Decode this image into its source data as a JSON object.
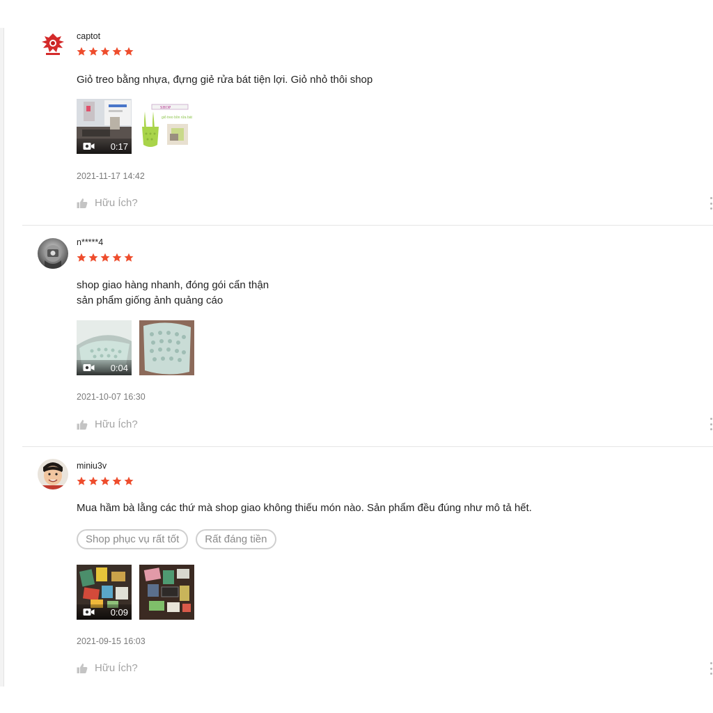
{
  "colors": {
    "star": "#ee4d2d",
    "muted_text": "#a3a3a3",
    "date_text": "#7a7a7a",
    "divider": "#e5e5e5"
  },
  "reviews": [
    {
      "username": "captot",
      "rating": 5,
      "comment_lines": [
        "Giỏ treo bằng nhựa, đựng giẻ rửa bát tiện lợi. Giỏ nhỏ thôi shop"
      ],
      "tags": [],
      "media": [
        {
          "type": "video",
          "duration": "0:17",
          "icon": "video-camera-icon"
        },
        {
          "type": "image",
          "logo_text": "SHOP",
          "caption_text": "giỏ treo bồn rửa bát"
        }
      ],
      "date": "2021-11-17 14:42",
      "helpful_label": "Hữu Ích?",
      "helpful_icon": "thumbs-up-icon"
    },
    {
      "username": "n*****4",
      "rating": 5,
      "comment_lines": [
        "shop giao hàng nhanh, đóng gói cẩn thận",
        "sản phẩm giống ảnh quảng cáo"
      ],
      "tags": [],
      "media": [
        {
          "type": "video",
          "duration": "0:04",
          "icon": "video-camera-icon"
        },
        {
          "type": "image"
        }
      ],
      "date": "2021-10-07 16:30",
      "helpful_label": "Hữu Ích?",
      "helpful_icon": "thumbs-up-icon"
    },
    {
      "username": "miniu3v",
      "rating": 5,
      "comment_lines": [
        "Mua hầm bà lằng các thứ mà shop giao không thiếu món nào. Sản phẩm đều đúng như mô tả hết."
      ],
      "tags": [
        "Shop phục vụ rất tốt",
        "Rất đáng tiền"
      ],
      "media": [
        {
          "type": "video",
          "duration": "0:09",
          "icon": "video-camera-icon"
        },
        {
          "type": "image"
        }
      ],
      "date": "2021-09-15 16:03",
      "helpful_label": "Hữu Ích?",
      "helpful_icon": "thumbs-up-icon"
    }
  ]
}
